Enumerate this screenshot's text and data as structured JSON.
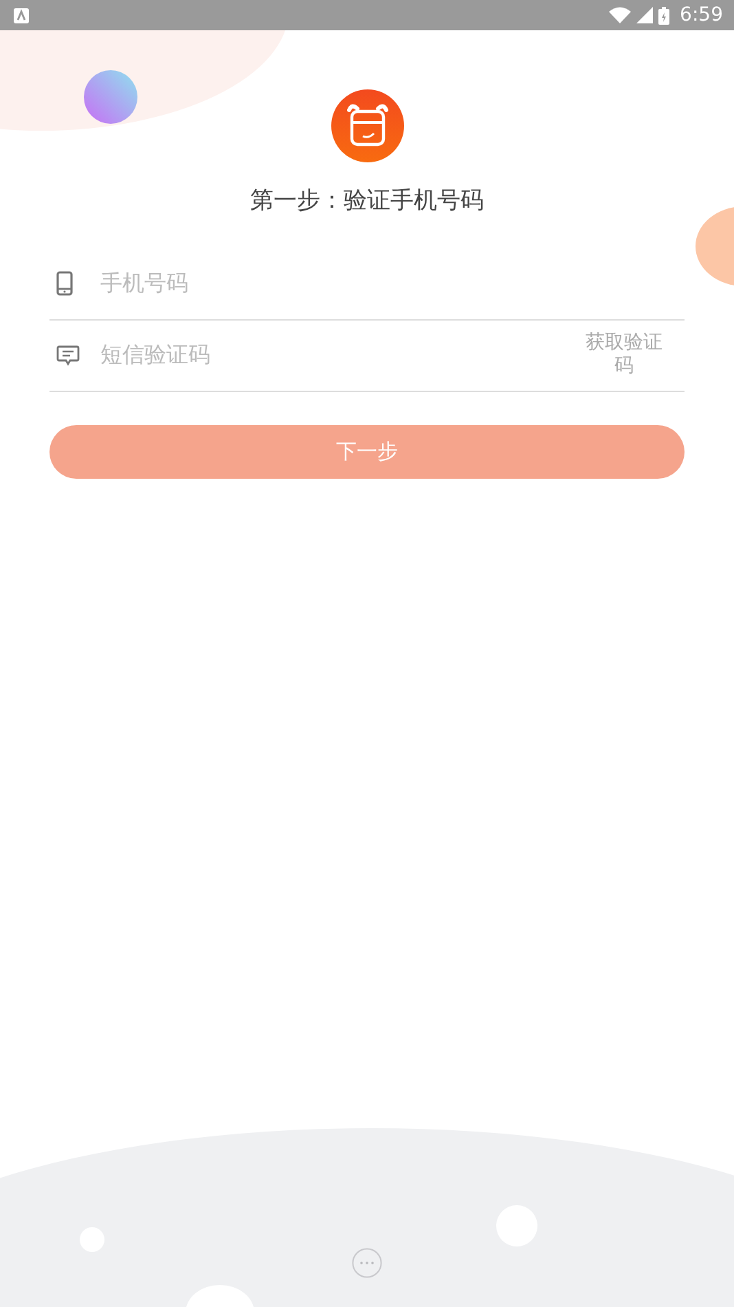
{
  "status_bar": {
    "time": "6:59"
  },
  "title": "第一步：验证手机号码",
  "fields": [
    {
      "kind": "phone",
      "placeholder": "手机号码"
    },
    {
      "kind": "sms",
      "placeholder": "短信验证码",
      "action": "获取验证码"
    }
  ],
  "next_button": {
    "label": "下一步",
    "disabled": true
  }
}
